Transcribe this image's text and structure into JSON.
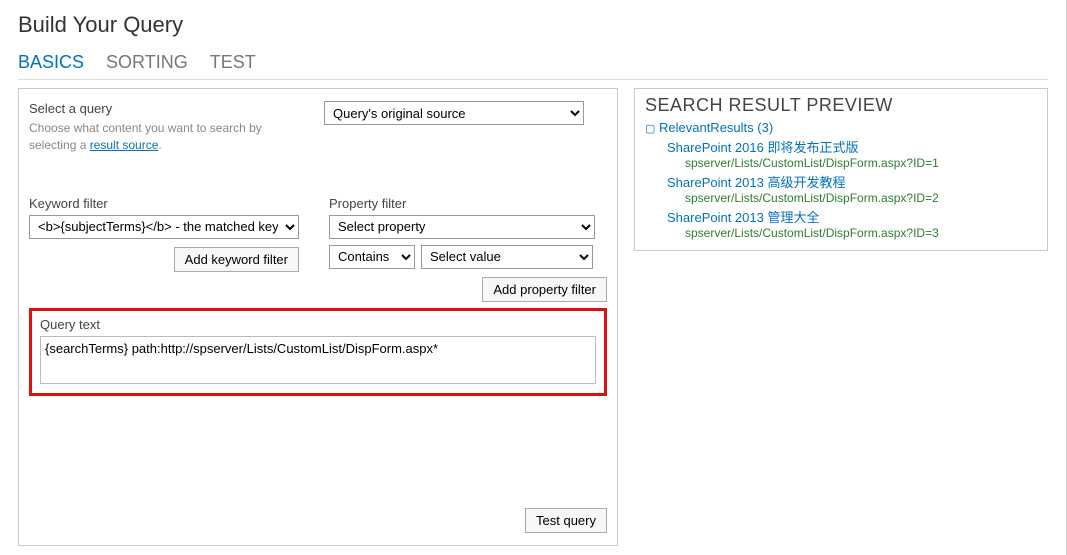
{
  "title": "Build Your Query",
  "tabs": {
    "basics": "BASICS",
    "sorting": "SORTING",
    "test": "TEST"
  },
  "selectQuery": {
    "label": "Select a query",
    "desc_before": "Choose what content you want to search by selecting a ",
    "desc_link": "result source",
    "desc_after": ".",
    "dropdown": "Query's original source"
  },
  "keywordFilter": {
    "label": "Keyword filter",
    "dropdown": "<b>{subjectTerms}</b> - the matched keyw",
    "button": "Add keyword filter"
  },
  "propertyFilter": {
    "label": "Property filter",
    "property": "Select property",
    "operator": "Contains",
    "value": "Select value",
    "button": "Add property filter"
  },
  "queryText": {
    "label": "Query text",
    "value": "{searchTerms} path:http://spserver/Lists/CustomList/DispForm.aspx*"
  },
  "testQueryButton": "Test query",
  "preview": {
    "title": "SEARCH RESULT PREVIEW",
    "root": "RelevantResults (3)",
    "results": [
      {
        "title": "SharePoint 2016 即将发布正式版",
        "url": "spserver/Lists/CustomList/DispForm.aspx?ID=1"
      },
      {
        "title": "SharePoint 2013 高级开发教程",
        "url": "spserver/Lists/CustomList/DispForm.aspx?ID=2"
      },
      {
        "title": "SharePoint 2013 管理大全",
        "url": "spserver/Lists/CustomList/DispForm.aspx?ID=3"
      }
    ]
  }
}
